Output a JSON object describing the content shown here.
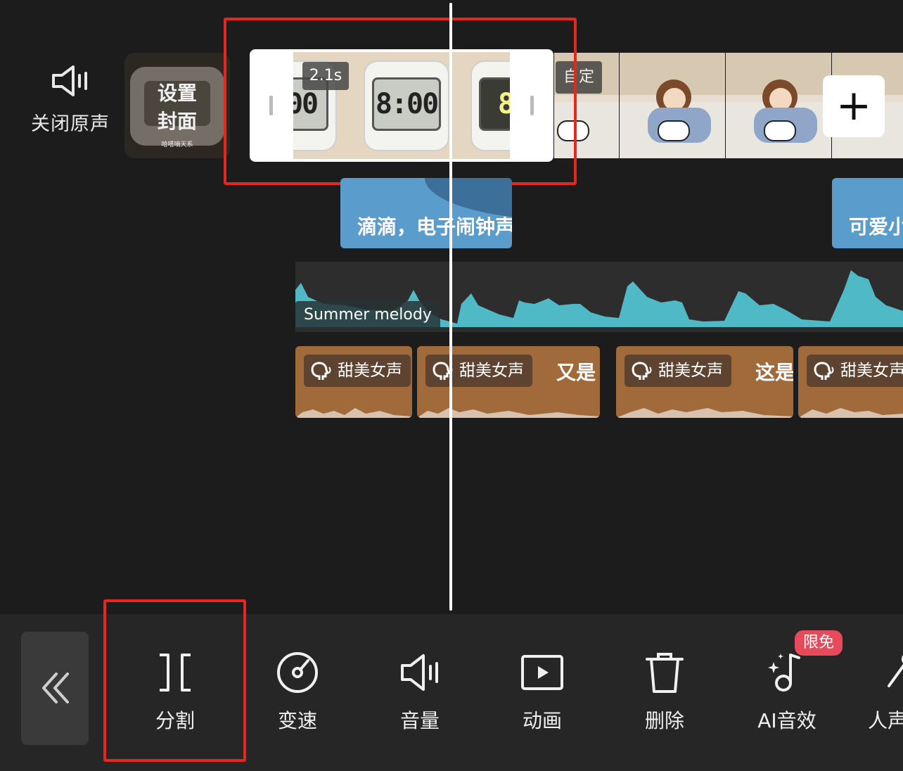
{
  "audio_toggle": {
    "label": "关闭原声",
    "icon": "speaker-icon"
  },
  "cover": {
    "label": "设置\n封面",
    "line1": "设置",
    "line2": "封面",
    "caption": "哈嗒嘀天系"
  },
  "selected_clip": {
    "duration": "2.1s",
    "thumb_times": [
      ":00",
      "8:00",
      "8:"
    ]
  },
  "next_clip": {
    "tag": "自定"
  },
  "add_button": {
    "symbol": "+"
  },
  "text_tracks": [
    {
      "label": "滴滴，电子闹钟声"
    },
    {
      "label": "可爱小"
    }
  ],
  "music_track": {
    "label": "Summer melody",
    "color": "#4fb9c6"
  },
  "voice_tracks": [
    {
      "voice": "甜美女声",
      "text": ""
    },
    {
      "voice": "甜美女声",
      "text": "又是"
    },
    {
      "voice": "甜美女声",
      "text": "这是"
    },
    {
      "voice": "甜美女声",
      "text": ""
    }
  ],
  "toolbar": {
    "back_icon": "double-chevron-left-icon",
    "items": [
      {
        "label": "分割",
        "icon": "split-icon"
      },
      {
        "label": "变速",
        "icon": "speed-icon"
      },
      {
        "label": "音量",
        "icon": "volume-icon"
      },
      {
        "label": "动画",
        "icon": "animation-icon"
      },
      {
        "label": "删除",
        "icon": "trash-icon"
      },
      {
        "label": "AI音效",
        "icon": "ai-sound-icon"
      },
      {
        "label": "人声",
        "icon": "voice-icon"
      }
    ],
    "badge": "限免"
  },
  "colors": {
    "highlight": "#e8261d",
    "text_clip": "#5a9ccb",
    "voice_clip": "#a06a3a",
    "badge": "#e74a5a"
  }
}
